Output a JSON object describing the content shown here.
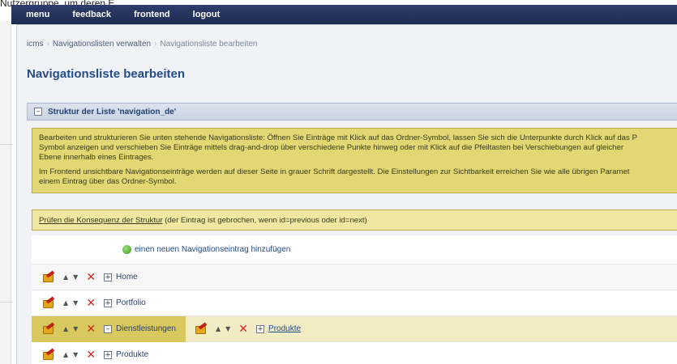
{
  "background": {
    "top_text": "Nutzergruppe, um deren E"
  },
  "topbar": {
    "items": [
      "menu",
      "feedback",
      "frontend",
      "logout"
    ]
  },
  "breadcrumb": {
    "items": [
      "icms",
      "Navigationslisten verwalten",
      "Navigationsliste bearbeiten"
    ]
  },
  "page": {
    "title": "Navigationsliste bearbeiten"
  },
  "section": {
    "toggle": "–",
    "title": "Struktur der Liste 'navigation_de'"
  },
  "notice": {
    "lines": [
      "Bearbeiten und strukturieren Sie unten stehende Navigationsliste: Öffnen Sie Einträge mit Klick auf das Ordner-Symbol, lassen Sie sich die Unterpunkte durch Klick auf das P",
      "Symbol anzeigen und verschieben Sie Einträge mittels drag-and-drop über verschiedene Punkte hinweg oder mit Klick auf die Pfeiltasten bei Verschiebungen auf gleicher",
      "Ebene innerhalb eines Eintrages.",
      "Im Frontend unsichtbare Navigationseinträge werden auf dieser Seite in grauer Schrift dargestellt. Die Einstellungen zur Sichtbarkeit erreichen Sie wie alle übrigen Paramet",
      "einem Eintrag über das Ordner-Symbol."
    ]
  },
  "check": {
    "link": "Prüfen die Konsequenz der Struktur",
    "text": " (der Eintrag ist gebrochen, wenn id=previous oder id=next)"
  },
  "list": {
    "add_label": "einen neuen Navigationseintrag hinzufügen",
    "up": "▲",
    "down": "▼",
    "delete": "✕",
    "expand": "+",
    "collapse": "–",
    "entries": [
      {
        "label": "Home"
      },
      {
        "label": "Portfolio"
      },
      {
        "label": "Dienstleistungen",
        "child": "Produkte"
      },
      {
        "label": "Produkte"
      }
    ]
  }
}
